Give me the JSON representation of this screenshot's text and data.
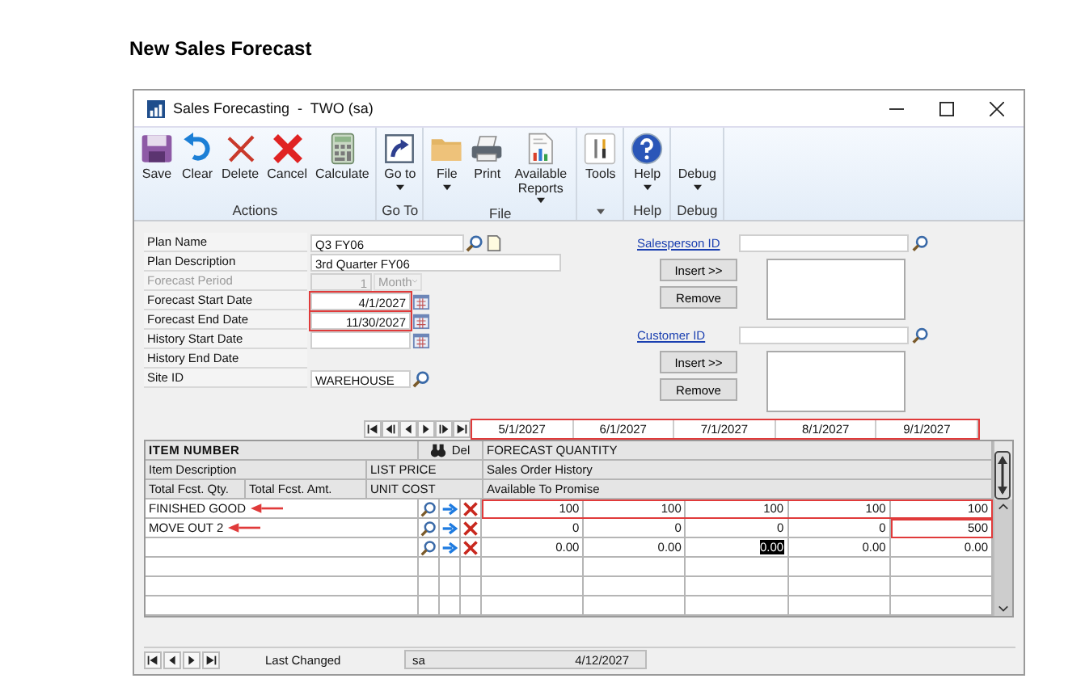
{
  "heading": "New Sales Forecast",
  "window": {
    "title": "Sales Forecasting  -  TWO (sa)"
  },
  "ribbon": {
    "groups": [
      {
        "label": "Actions",
        "buttons": [
          {
            "label": "Save"
          },
          {
            "label": "Clear"
          },
          {
            "label": "Delete"
          },
          {
            "label": "Cancel"
          },
          {
            "label": "Calculate"
          }
        ]
      },
      {
        "label": "Go To",
        "buttons": [
          {
            "label": "Go to",
            "dropdown": true
          }
        ]
      },
      {
        "label": "File",
        "buttons": [
          {
            "label": "File",
            "dropdown": true
          },
          {
            "label": "Print"
          },
          {
            "label": "Available Reports",
            "dropdown": true
          }
        ]
      },
      {
        "launcher": true,
        "buttons": [
          {
            "label": "Tools"
          }
        ]
      },
      {
        "label": "Help",
        "buttons": [
          {
            "label": "Help",
            "dropdown": true
          }
        ]
      },
      {
        "label": "Debug",
        "buttons": [
          {
            "label": "Debug",
            "dropdown": true
          }
        ]
      }
    ]
  },
  "form": {
    "fields": [
      {
        "label": "Plan Name",
        "kind": "lookup-note",
        "value": "Q3 FY06",
        "disabled": false
      },
      {
        "label": "Plan Description",
        "kind": "wide",
        "value": "3rd Quarter FY06",
        "disabled": false
      },
      {
        "label": "Forecast Period",
        "kind": "period",
        "value": "1",
        "unit": "Month",
        "disabled": true
      },
      {
        "label": "Forecast Start Date",
        "kind": "date",
        "value": "4/1/2027",
        "disabled": false,
        "highlighted": true
      },
      {
        "label": "Forecast End Date",
        "kind": "date",
        "value": "11/30/2027",
        "disabled": false,
        "highlighted": true
      },
      {
        "label": "History Start Date",
        "kind": "date",
        "disabled": false,
        "highlighted": false
      },
      {
        "label": "History End Date",
        "kind": "none",
        "disabled": false
      },
      {
        "label": "Site ID",
        "kind": "lookup",
        "value": "WAREHOUSE",
        "disabled": false
      }
    ]
  },
  "selectors": [
    {
      "link": "Salesperson ID",
      "insert": "Insert >>",
      "remove": "Remove"
    },
    {
      "link": "Customer ID",
      "insert": "Insert >>",
      "remove": "Remove"
    }
  ],
  "grid": {
    "dates": [
      "5/1/2027",
      "6/1/2027",
      "7/1/2027",
      "8/1/2027",
      "9/1/2027"
    ],
    "dates_highlighted": true,
    "header": {
      "item_number": "ITEM NUMBER",
      "del": "Del",
      "forecast_quantity": "FORECAST QUANTITY",
      "item_description": "Item Description",
      "list_price": "LIST PRICE",
      "sales_order_history": "Sales Order History",
      "total_qty": "Total Fcst. Qty.",
      "total_amt": "Total Fcst. Amt.",
      "unit_cost": "UNIT COST",
      "available": "Available To Promise"
    },
    "rows": [
      {
        "item": "FINISHED GOOD",
        "arrow": true,
        "highlighted": true,
        "cells": [
          {
            "text": "100",
            "highlighted": false,
            "focused": false
          },
          {
            "text": "100",
            "highlighted": false,
            "focused": false
          },
          {
            "text": "100",
            "highlighted": false,
            "focused": false
          },
          {
            "text": "100",
            "highlighted": false,
            "focused": false
          },
          {
            "text": "100",
            "highlighted": false,
            "focused": false
          }
        ]
      },
      {
        "item": "MOVE OUT 2",
        "arrow": true,
        "highlighted": false,
        "cells": [
          {
            "text": "0",
            "highlighted": false,
            "focused": false
          },
          {
            "text": "0",
            "highlighted": false,
            "focused": false
          },
          {
            "text": "0",
            "highlighted": false,
            "focused": false
          },
          {
            "text": "0",
            "highlighted": false,
            "focused": false
          },
          {
            "text": "500",
            "highlighted": true,
            "focused": false
          }
        ]
      },
      {
        "highlighted": false,
        "cells": [
          {
            "text": "0.00",
            "highlighted": false,
            "focused": false
          },
          {
            "text": "0.00",
            "highlighted": false,
            "focused": false
          },
          {
            "text": "0.00",
            "highlighted": false,
            "focused": true
          },
          {
            "text": "0.00",
            "highlighted": false,
            "focused": false
          },
          {
            "text": "0.00",
            "highlighted": false,
            "focused": false
          }
        ]
      }
    ]
  },
  "status_bar": {
    "label": "Last Changed",
    "user": "sa",
    "date": "4/12/2027"
  }
}
